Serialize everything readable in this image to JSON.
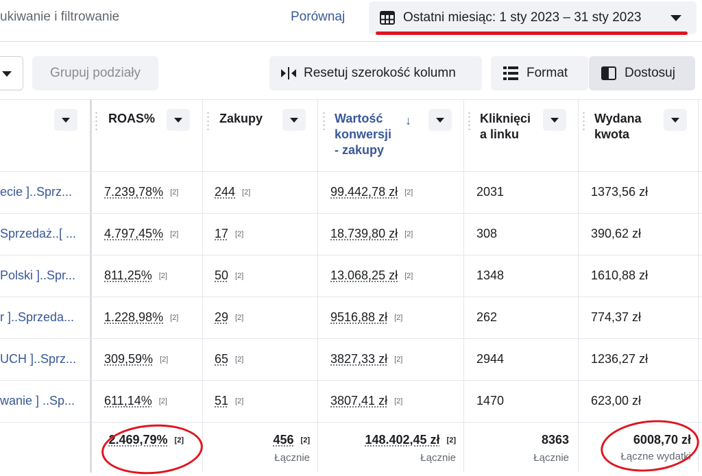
{
  "topbar": {
    "filter_text": "ukiwanie i filtrowanie",
    "compare_label": "Porównaj",
    "date_range_label": "Ostatni miesiąc: 1 sty 2023 – 31 sty 2023"
  },
  "toolbar": {
    "group_label": "Grupuj podziały",
    "reset_label": "Resetuj szerokość kolumn",
    "format_label": "Format",
    "adjust_label": "Dostosuj"
  },
  "columns": {
    "roas": "ROAS%",
    "purchases": "Zakupy",
    "conv_value_l1": "Wartość",
    "conv_value_l2": "konwersji",
    "conv_value_l3": "- zakupy",
    "clicks_l1": "Kliknięci",
    "clicks_l2": "a linku",
    "spend_l1": "Wydana",
    "spend_l2": "kwota",
    "sort_arrow": "↓"
  },
  "rows": [
    {
      "name": "ecie ]..Sprz...",
      "roas": "7.239,78%",
      "purchases": "244",
      "value": "99.442,78 zł",
      "clicks": "2031",
      "spend": "1373,56 zł"
    },
    {
      "name": "Sprzedaż..[ ...",
      "roas": "4.797,45%",
      "purchases": "17",
      "value": "18.739,80 zł",
      "clicks": "308",
      "spend": "390,62 zł"
    },
    {
      "name": "Polski ]..Spr...",
      "roas": "811,25%",
      "purchases": "50",
      "value": "13.068,25 zł",
      "clicks": "1348",
      "spend": "1610,88 zł"
    },
    {
      "name": "r ]..Sprzeda...",
      "roas": "1.228,98%",
      "purchases": "29",
      "value": "9516,88 zł",
      "clicks": "262",
      "spend": "774,37 zł"
    },
    {
      "name": "UCH ]..Sprz...",
      "roas": "309,59%",
      "purchases": "65",
      "value": "3827,33 zł",
      "clicks": "2944",
      "spend": "1236,27 zł"
    },
    {
      "name": "wanie ] ..Sp...",
      "roas": "611,14%",
      "purchases": "51",
      "value": "3807,41 zł",
      "clicks": "1470",
      "spend": "623,00 zł"
    }
  ],
  "note_marker": "[2]",
  "totals": {
    "roas": "2.469,79%",
    "purchases": "456",
    "value": "148.402,45 zł",
    "clicks": "8363",
    "spend": "6008,70 zł",
    "sum_label": "Łącznie",
    "spend_label": "Łączne wydatki"
  },
  "colors": {
    "link_blue": "#385898",
    "annotation_red": "#e0141e"
  }
}
